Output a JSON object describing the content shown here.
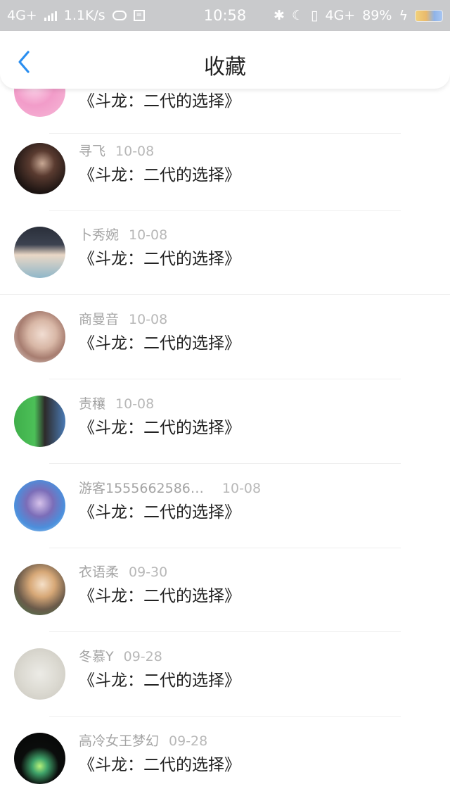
{
  "status_bar": {
    "network_left": "4G+",
    "speed": "1.1K/s",
    "time": "10:58",
    "network_right": "4G+",
    "battery_percent": "89%"
  },
  "header": {
    "title": "收藏"
  },
  "favorites": [
    {
      "user": "",
      "date": "",
      "book": "《斗龙：二代的选择》"
    },
    {
      "user": "寻飞",
      "date": "10-08",
      "book": "《斗龙：二代的选择》"
    },
    {
      "user": "卜秀婉",
      "date": "10-08",
      "book": "《斗龙：二代的选择》"
    },
    {
      "user": "商曼音",
      "date": "10-08",
      "book": "《斗龙：二代的选择》"
    },
    {
      "user": "责穰",
      "date": "10-08",
      "book": "《斗龙：二代的选择》"
    },
    {
      "user": "游客1555662586…",
      "date": "10-08",
      "book": "《斗龙：二代的选择》"
    },
    {
      "user": "衣语柔",
      "date": "09-30",
      "book": "《斗龙：二代的选择》"
    },
    {
      "user": "冬慕Y",
      "date": "09-28",
      "book": "《斗龙：二代的选择》"
    },
    {
      "user": "高冷女王梦幻",
      "date": "09-28",
      "book": "《斗龙：二代的选择》"
    }
  ]
}
